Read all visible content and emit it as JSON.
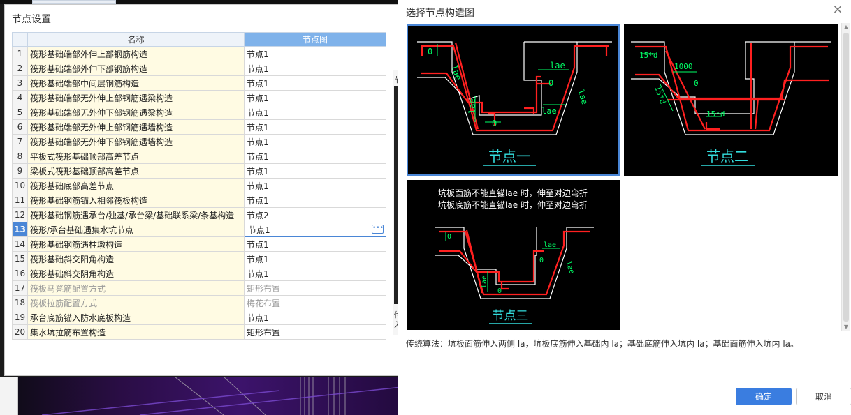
{
  "left_dialog": {
    "title": "节点设置",
    "col_name": "名称",
    "col_node": "节点图",
    "rows": [
      {
        "no": "1",
        "name": "筏形基础端部外伸上部钢筋构造",
        "node": "节点1"
      },
      {
        "no": "2",
        "name": "筏形基础端部外伸下部钢筋构造",
        "node": "节点1"
      },
      {
        "no": "3",
        "name": "筏形基础端部中间层钢筋构造",
        "node": "节点1"
      },
      {
        "no": "4",
        "name": "筏形基础端部无外伸上部钢筋遇梁构造",
        "node": "节点1"
      },
      {
        "no": "5",
        "name": "筏形基础端部无外伸下部钢筋遇梁构造",
        "node": "节点1"
      },
      {
        "no": "6",
        "name": "筏形基础端部无外伸上部钢筋遇墙构造",
        "node": "节点1"
      },
      {
        "no": "7",
        "name": "筏形基础端部无外伸下部钢筋遇墙构造",
        "node": "节点1"
      },
      {
        "no": "8",
        "name": "平板式筏形基础顶部高差节点",
        "node": "节点1"
      },
      {
        "no": "9",
        "name": "梁板式筏形基础顶部高差节点",
        "node": "节点1"
      },
      {
        "no": "10",
        "name": "筏形基础底部高差节点",
        "node": "节点1"
      },
      {
        "no": "11",
        "name": "筏形基础钢筋锚入相邻筏板构造",
        "node": "节点1"
      },
      {
        "no": "12",
        "name": "筏形基础钢筋遇承台/独基/承台梁/基础联系梁/条基构造",
        "node": "节点2"
      },
      {
        "no": "13",
        "name": "筏形/承台基础遇集水坑节点",
        "node": "节点1"
      },
      {
        "no": "14",
        "name": "筏形基础钢筋遇柱墩构造",
        "node": "节点1"
      },
      {
        "no": "15",
        "name": "筏形基础斜交阳角构造",
        "node": "节点1"
      },
      {
        "no": "16",
        "name": "筏形基础斜交阴角构造",
        "node": "节点1"
      },
      {
        "no": "17",
        "name": "筏板马凳筋配置方式",
        "node": "矩形布置"
      },
      {
        "no": "18",
        "name": "筏板拉筋配置方式",
        "node": "梅花布置"
      },
      {
        "no": "19",
        "name": "承台底筋锚入防水底板构造",
        "node": "节点1"
      },
      {
        "no": "20",
        "name": "集水坑拉筋布置构造",
        "node": "矩形布置"
      }
    ],
    "side_strip_top": "节",
    "side_strip_bottom": "传\n入"
  },
  "right_dialog": {
    "title": "选择节点构造图",
    "close_glyph": "×",
    "node1_label": "节点一",
    "node2_label": "节点二",
    "node3_label": "节点三",
    "node3_note_line1": "坑板面筋不能直锚lae 时，伸至对边弯折",
    "node3_note_line2": "坑板底筋不能直锚lae 时，伸至对边弯折",
    "dim_lae": "lae",
    "dim_zero": "0",
    "dim_15d": "15*d",
    "dim_1000": "1000",
    "description": "传统算法：坑板面筋伸入两侧 la，坑板底筋伸入基础内 la；基础底筋伸入坑内 la；基础面筋伸入坑内 la。",
    "ok_label": "确定",
    "cancel_label": "取消"
  },
  "colors": {
    "accent": "#3a7de0",
    "rebar": "#ff2020",
    "dimension": "#00ff66",
    "caption": "#33dddd"
  }
}
